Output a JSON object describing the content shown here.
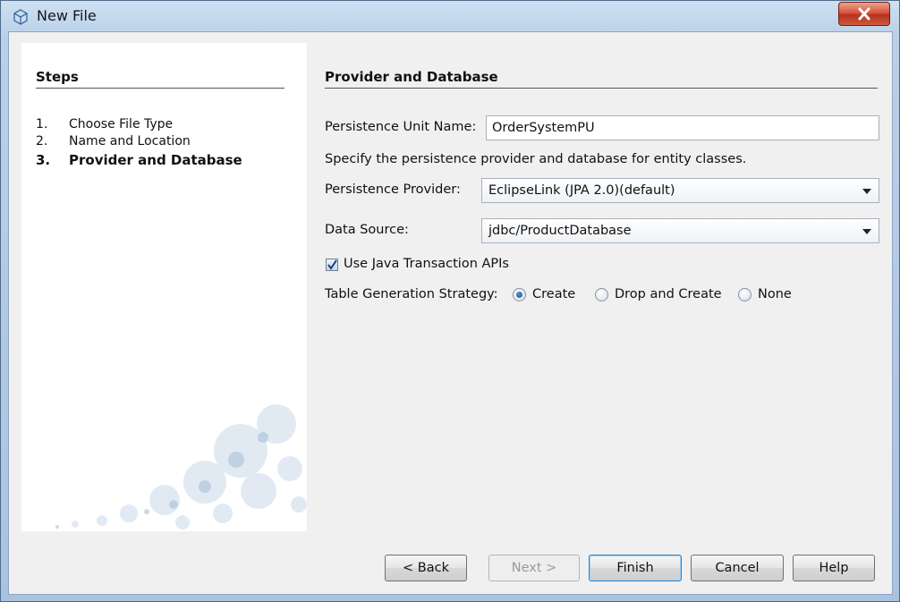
{
  "window": {
    "title": "New File",
    "close_label": "x"
  },
  "steps": {
    "heading": "Steps",
    "items": [
      {
        "num": "1.",
        "label": "Choose File Type"
      },
      {
        "num": "2.",
        "label": "Name and Location"
      },
      {
        "num": "3.",
        "label": "Provider and Database"
      }
    ]
  },
  "panel": {
    "heading": "Provider and Database",
    "unit_name_label": "Persistence Unit Name:",
    "unit_name_value": "OrderSystemPU",
    "description": "Specify the persistence provider and database for entity classes.",
    "provider_label": "Persistence Provider:",
    "provider_value": "EclipseLink (JPA 2.0)(default)",
    "datasource_label": "Data Source:",
    "datasource_value": "jdbc/ProductDatabase",
    "jta_label": "Use Java Transaction APIs",
    "jta_checked": true,
    "strategy_label": "Table Generation Strategy:",
    "strategy_options": [
      "Create",
      "Drop and Create",
      "None"
    ],
    "strategy_selected": "Create"
  },
  "buttons": {
    "back": "< Back",
    "next": "Next >",
    "finish": "Finish",
    "cancel": "Cancel",
    "help": "Help"
  },
  "icons": {
    "title": "netbeans-cube-icon",
    "close": "close-icon",
    "dropdown": "chevron-down-icon",
    "check": "check-icon"
  },
  "colors": {
    "close_button": "#cc4a33",
    "default_button_border": "#3c7fb1"
  }
}
